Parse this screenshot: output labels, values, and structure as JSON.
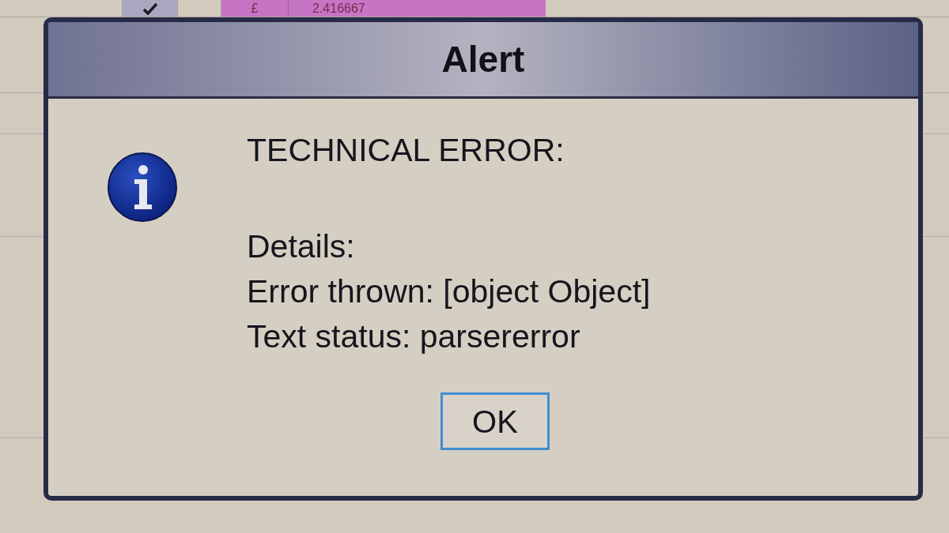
{
  "sheet": {
    "currency_cell": "£",
    "value_cell": "2.416667"
  },
  "dialog": {
    "title": "Alert",
    "heading": "TECHNICAL ERROR:",
    "details_label": "Details:",
    "lines": [
      "Error thrown: [object Object]",
      "Text status: parsererror"
    ],
    "buttons": [
      {
        "label": "OK",
        "focused": true
      }
    ]
  }
}
